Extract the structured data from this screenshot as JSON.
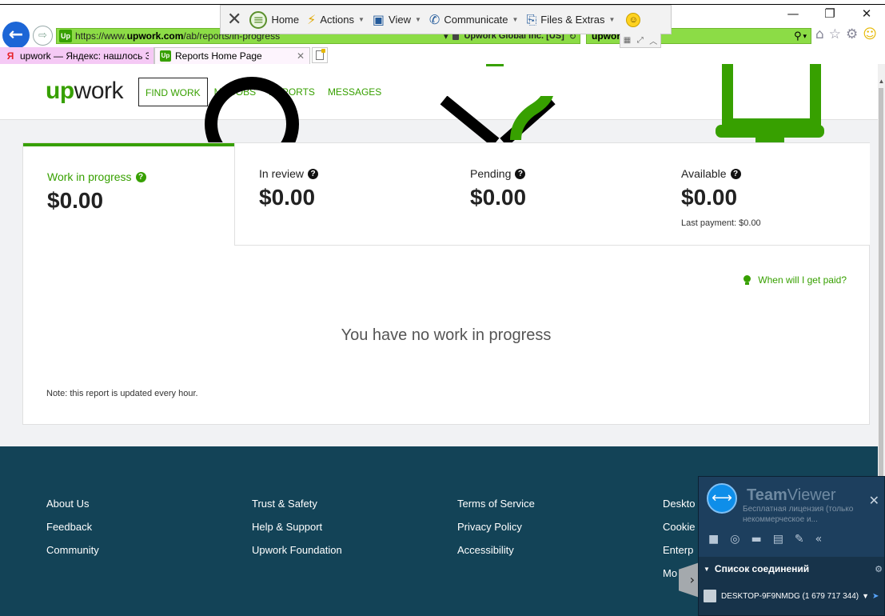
{
  "browser": {
    "address": {
      "url_prefix": "https://www.",
      "url_domain": "upwork.com",
      "url_path": "/ab/reports/in-progress",
      "certificate": "Upwork Global Inc. [US]"
    },
    "search": {
      "value": "upwor"
    },
    "window_controls": {
      "minimize": "—",
      "restore": "❐",
      "close": "✕"
    },
    "tabs": [
      {
        "title": "upwork — Яндекс: нашлось 3...",
        "favicon": "Я"
      },
      {
        "title": "Reports Home Page",
        "favicon": "Up",
        "close": "✕"
      }
    ]
  },
  "tv_toolbar": {
    "close": "✕",
    "home": "Home",
    "actions": "Actions",
    "view": "View",
    "communicate": "Communicate",
    "files": "Files & Extras"
  },
  "upwork": {
    "logo_up": "up",
    "logo_work": "work",
    "nav": [
      "FIND WORK",
      "MY JOBS",
      "REPORTS",
      "MESSAGES"
    ],
    "stats": {
      "in_progress": {
        "label": "Work in progress",
        "amount": "$0.00"
      },
      "in_review": {
        "label": "In review",
        "amount": "$0.00"
      },
      "pending": {
        "label": "Pending",
        "amount": "$0.00"
      },
      "available": {
        "label": "Available",
        "amount": "$0.00",
        "last_payment": "Last payment: $0.00"
      }
    },
    "paid_link": "When will I get paid?",
    "empty_message": "You have no work in progress",
    "note": "Note: this report is updated every hour."
  },
  "footer": {
    "col1": [
      "About Us",
      "Feedback",
      "Community"
    ],
    "col2": [
      "Trust & Safety",
      "Help & Support",
      "Upwork Foundation"
    ],
    "col3": [
      "Terms of Service",
      "Privacy Policy",
      "Accessibility"
    ],
    "col4": [
      "Deskto",
      "Cookie",
      "Enterp",
      "Mo"
    ]
  },
  "teamviewer": {
    "brand_team": "Team",
    "brand_viewer": "Viewer",
    "license": "Бесплатная лицензия (только некоммерческое и...",
    "connections_title": "Список соединений",
    "connection": "DESKTOP-9F9NMDG (1 679 717 344)"
  },
  "colors": {
    "accent": "#37a000",
    "footer": "#134357",
    "address_bar": "#8cdc46",
    "back_button": "#1c66d6"
  }
}
